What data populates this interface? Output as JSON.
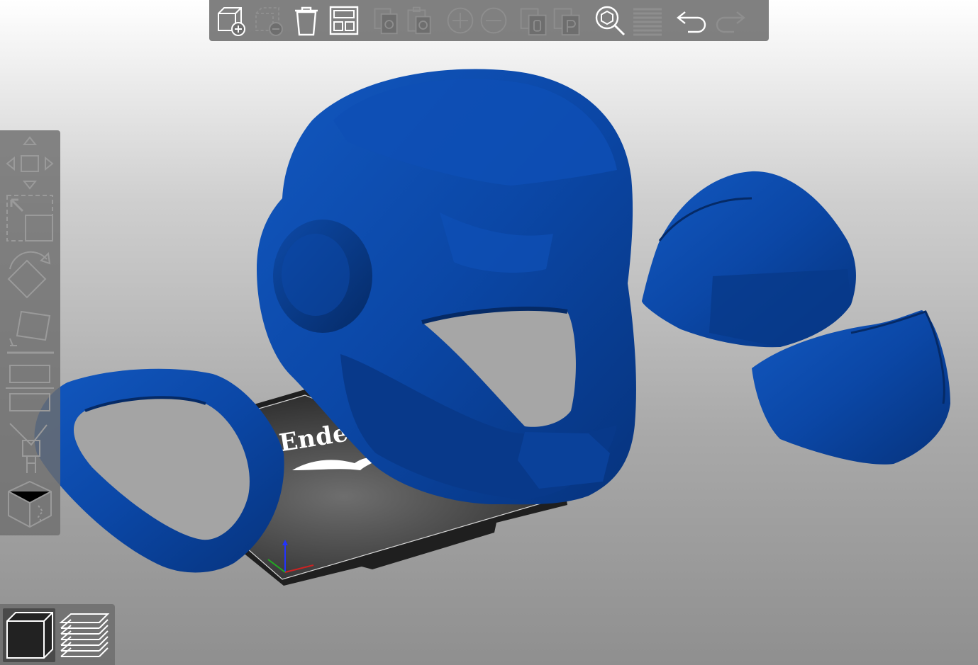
{
  "app": {
    "accent_color": "#0b3f8f",
    "model_color": "#0b47a6"
  },
  "bed": {
    "label": "Ender"
  },
  "top_toolbar": {
    "buttons": [
      {
        "name": "add-object",
        "icon": "cube-plus-icon",
        "enabled": true
      },
      {
        "name": "delete-object",
        "icon": "cube-minus-icon",
        "enabled": false
      },
      {
        "name": "delete-all",
        "icon": "trash-icon",
        "enabled": true
      },
      {
        "name": "arrange",
        "icon": "arrange-icon",
        "enabled": true
      },
      {
        "name": "copy",
        "icon": "copy-icon",
        "enabled": false
      },
      {
        "name": "paste",
        "icon": "paste-icon",
        "enabled": false
      },
      {
        "name": "add-instance",
        "icon": "plus-circle-icon",
        "enabled": false
      },
      {
        "name": "remove-instance",
        "icon": "minus-circle-icon",
        "enabled": false
      },
      {
        "name": "split-objects",
        "icon": "split-objects-icon",
        "enabled": false
      },
      {
        "name": "split-parts",
        "icon": "split-parts-icon",
        "enabled": false
      },
      {
        "name": "search",
        "icon": "search-icon",
        "enabled": true
      },
      {
        "name": "layers-editing",
        "icon": "layers-icon",
        "enabled": false
      },
      {
        "name": "undo",
        "icon": "undo-icon",
        "enabled": true
      },
      {
        "name": "redo",
        "icon": "redo-icon",
        "enabled": false
      }
    ]
  },
  "left_toolbar": {
    "tools": [
      "move-icon",
      "scale-icon",
      "rotate-icon",
      "place-on-face-icon",
      "cut-icon",
      "paint-support-icon",
      "seam-icon"
    ]
  },
  "view_toolbar": {
    "modes": [
      {
        "name": "3d-view",
        "icon": "cube-view-icon",
        "active": true
      },
      {
        "name": "preview",
        "icon": "layers-preview-icon",
        "active": false
      }
    ]
  }
}
